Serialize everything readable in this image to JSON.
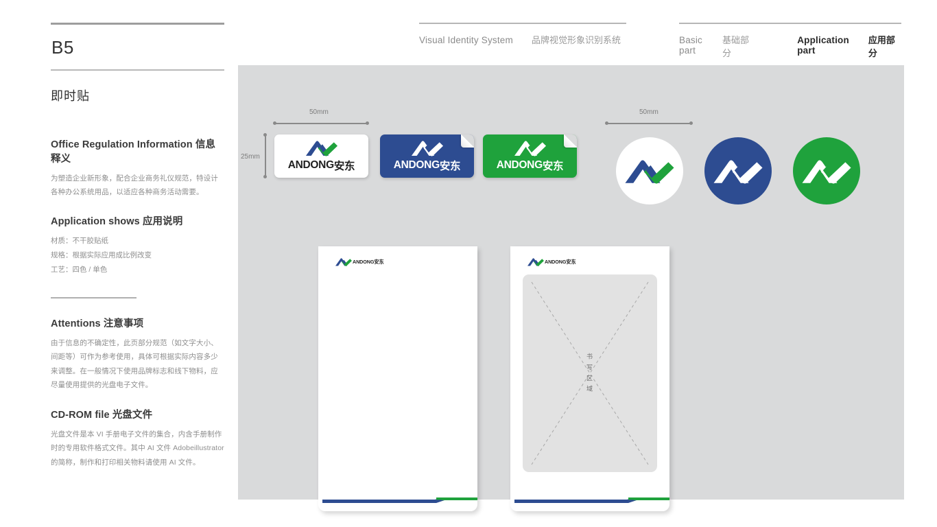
{
  "header": {
    "group1": {
      "en": "Visual Identity System",
      "cn": "品牌视觉形象识别系统"
    },
    "group2": {
      "basic_en": "Basic part",
      "basic_cn": "基础部分",
      "app_en": "Application part",
      "app_cn": "应用部分"
    }
  },
  "sidebar": {
    "code": "B5",
    "page_title": "即时贴",
    "sections": [
      {
        "head_en": "Office Regulation Information",
        "head_cn": "信息释义",
        "body": "为塑造企业新形象，配合企业商务礼仪规范，特设计各种办公系统用品，以适应各种商务活动需要。"
      },
      {
        "head_en": "Application shows",
        "head_cn": "应用说明",
        "lines": [
          "材质：不干胶贴纸",
          "规格：根据实际应用成比例改变",
          "工艺：四色 / 单色"
        ]
      },
      {
        "head_en": "Attentions",
        "head_cn": "注意事项",
        "body": "由于信息的不确定性，此页部分规范（如文字大小、间距等）可作为参考使用，具体可根据实际内容多少来调整。在一般情况下使用品牌标志和线下物料，应尽量使用提供的光盘电子文件。"
      },
      {
        "head_en": "CD-ROM file",
        "head_cn": "光盘文件",
        "body": "光盘文件是本 VI 手册电子文件的集合，内含手册制作时的专用软件格式文件。其中 AI 文件 Adobeillustrator 的简称，制作和打印相关物料请使用 AI 文件。"
      }
    ]
  },
  "canvas": {
    "dimensions": {
      "sticky_width": "50mm",
      "sticky_height": "25mm",
      "circle_width": "50mm"
    },
    "brand": {
      "latin": "ANDONG",
      "han": "安东",
      "blue": "#2d4c91",
      "green": "#1fa23c",
      "white": "#ffffff",
      "canvas_bg": "#d9dadb"
    },
    "stickers": [
      {
        "variant": "white",
        "latin": "ANDONG",
        "han": "安东",
        "text_color": "#1f1f1f"
      },
      {
        "variant": "blue",
        "latin": "ANDONG",
        "han": "安东",
        "text_color": "#ffffff"
      },
      {
        "variant": "green",
        "latin": "ANDONG",
        "han": "安东",
        "text_color": "#ffffff"
      }
    ],
    "circles": [
      {
        "variant": "white"
      },
      {
        "variant": "blue"
      },
      {
        "variant": "green"
      }
    ],
    "notepads": [
      {
        "has_write_area": false,
        "latin": "ANDONG",
        "han": "安东"
      },
      {
        "has_write_area": true,
        "latin": "ANDONG",
        "han": "安东",
        "write_label": "书写区域"
      }
    ]
  }
}
